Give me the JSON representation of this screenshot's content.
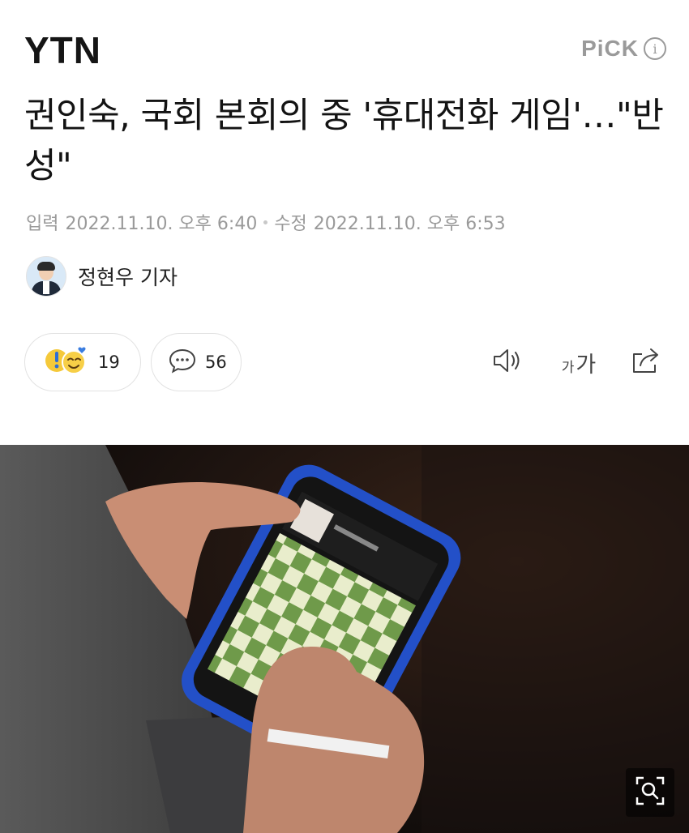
{
  "header": {
    "brand": "YTN",
    "pick_label": "PiCK",
    "info_symbol": "i"
  },
  "article": {
    "headline": "권인숙, 국회 본회의 중 '휴대전화 게임'…\"반성\"",
    "input_label": "입력",
    "input_datetime": "2022.11.10. 오후 6:40",
    "modified_label": "수정",
    "modified_datetime": "2022.11.10. 오후 6:53",
    "reporter": "정현우 기자"
  },
  "actions": {
    "reaction_count": "19",
    "comment_count": "56",
    "font_small": "가",
    "font_large": "가"
  },
  "icons": {
    "info": "info-icon",
    "reaction": "reaction-emoji-icon",
    "comment": "comment-bubble-icon",
    "audio": "speaker-icon",
    "share": "share-icon",
    "zoom": "zoom-magnifier-icon"
  },
  "colors": {
    "muted_text": "#9a9a9a",
    "reaction_yellow": "#f5c93a",
    "reaction_blue": "#3a7de0",
    "phone_case_blue": "#2350c8",
    "chess_green": "#6f9a4a",
    "chess_light": "#e9edcc"
  }
}
